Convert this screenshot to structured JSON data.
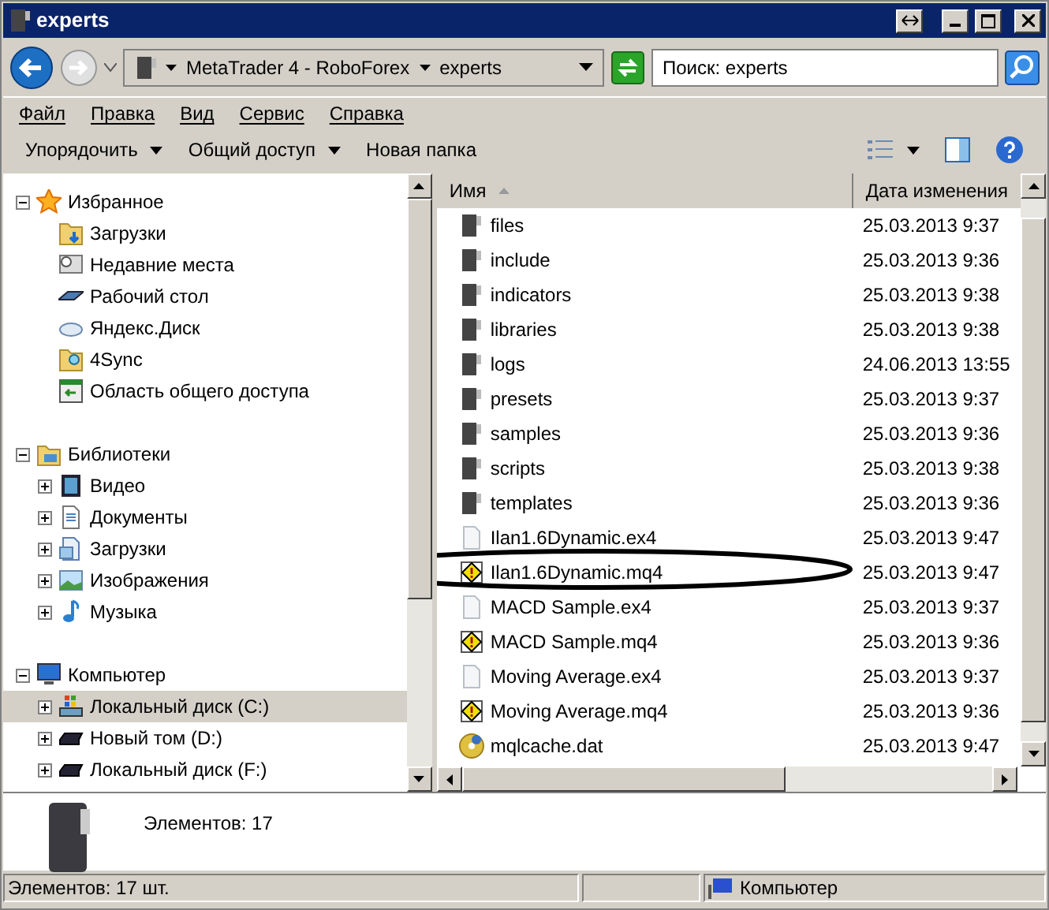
{
  "window": {
    "title": "experts"
  },
  "address": {
    "crumbs": [
      "MetaTrader 4 - RoboForex",
      "experts"
    ]
  },
  "search": {
    "placeholder": "Поиск: experts"
  },
  "menu": [
    "Файл",
    "Правка",
    "Вид",
    "Сервис",
    "Справка"
  ],
  "toolbar": [
    {
      "label": "Упорядочить",
      "dropdown": true
    },
    {
      "label": "Общий доступ",
      "dropdown": true
    },
    {
      "label": "Новая папка",
      "dropdown": false
    }
  ],
  "tree": [
    {
      "label": "Избранное",
      "expanded": true,
      "selected": false,
      "children": [
        {
          "label": "Загрузки",
          "selected": false
        },
        {
          "label": "Недавние места",
          "selected": false
        },
        {
          "label": "Рабочий стол",
          "selected": false
        },
        {
          "label": "Яндекс.Диск",
          "selected": false
        },
        {
          "label": "4Sync",
          "selected": false
        },
        {
          "label": "Область общего доступа",
          "selected": false
        }
      ]
    },
    {
      "label": "Библиотеки",
      "expanded": true,
      "selected": false,
      "children": [
        {
          "label": "Видео",
          "expanded": false,
          "selected": false
        },
        {
          "label": "Документы",
          "expanded": false,
          "selected": false
        },
        {
          "label": "Загрузки",
          "expanded": false,
          "selected": false
        },
        {
          "label": "Изображения",
          "expanded": false,
          "selected": false
        },
        {
          "label": "Музыка",
          "expanded": false,
          "selected": false
        }
      ]
    },
    {
      "label": "Компьютер",
      "expanded": true,
      "selected": false,
      "children": [
        {
          "label": "Локальный диск (C:)",
          "expanded": false,
          "selected": true
        },
        {
          "label": "Новый том (D:)",
          "expanded": false,
          "selected": false
        },
        {
          "label": "Локальный диск (F:)",
          "expanded": false,
          "selected": false
        }
      ]
    }
  ],
  "files": {
    "columns": [
      "Имя",
      "Дата изменения"
    ],
    "rows": [
      {
        "name": "files",
        "date": "25.03.2013 9:37",
        "kind": "folder"
      },
      {
        "name": "include",
        "date": "25.03.2013 9:36",
        "kind": "folder"
      },
      {
        "name": "indicators",
        "date": "25.03.2013 9:38",
        "kind": "folder"
      },
      {
        "name": "libraries",
        "date": "25.03.2013 9:38",
        "kind": "folder"
      },
      {
        "name": "logs",
        "date": "24.06.2013 13:55",
        "kind": "folder"
      },
      {
        "name": "presets",
        "date": "25.03.2013 9:37",
        "kind": "folder"
      },
      {
        "name": "samples",
        "date": "25.03.2013 9:36",
        "kind": "folder"
      },
      {
        "name": "scripts",
        "date": "25.03.2013 9:38",
        "kind": "folder"
      },
      {
        "name": "templates",
        "date": "25.03.2013 9:36",
        "kind": "folder"
      },
      {
        "name": "Ilan1.6Dynamic.ex4",
        "date": "25.03.2013 9:47",
        "kind": "blank"
      },
      {
        "name": "Ilan1.6Dynamic.mq4",
        "date": "25.03.2013 9:47",
        "kind": "source"
      },
      {
        "name": "MACD Sample.ex4",
        "date": "25.03.2013 9:37",
        "kind": "blank"
      },
      {
        "name": "MACD Sample.mq4",
        "date": "25.03.2013 9:36",
        "kind": "source"
      },
      {
        "name": "Moving Average.ex4",
        "date": "25.03.2013 9:37",
        "kind": "blank"
      },
      {
        "name": "Moving Average.mq4",
        "date": "25.03.2013 9:36",
        "kind": "source"
      },
      {
        "name": "mqlcache.dat",
        "date": "25.03.2013 9:47",
        "kind": "cache"
      }
    ]
  },
  "details": {
    "text": "Элементов: 17"
  },
  "status_bar": {
    "count": "Элементов: 17 шт.",
    "location": "Компьютер"
  }
}
